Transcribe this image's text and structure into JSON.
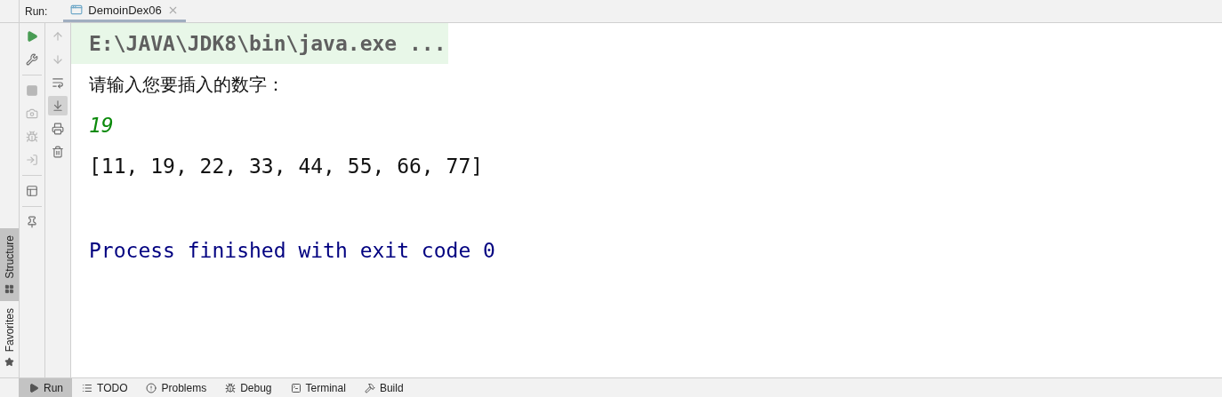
{
  "run_label": "Run:",
  "run_tab": {
    "label": "DemoinDex06",
    "selected": true
  },
  "side_tabs": [
    {
      "label": "Structure",
      "kind": "structure",
      "selected": true
    },
    {
      "label": "Favorites",
      "kind": "favorites",
      "selected": false
    }
  ],
  "tools_primary": [
    {
      "kind": "run",
      "disabled": false
    },
    {
      "kind": "wrench",
      "disabled": false
    },
    {
      "kind": "sep"
    },
    {
      "kind": "stop",
      "disabled": true
    },
    {
      "kind": "camera",
      "disabled": true
    },
    {
      "kind": "bug",
      "disabled": true
    },
    {
      "kind": "login",
      "disabled": true
    },
    {
      "kind": "sep"
    },
    {
      "kind": "layout",
      "disabled": false
    },
    {
      "kind": "sep"
    },
    {
      "kind": "pin",
      "disabled": false
    }
  ],
  "tools_secondary": [
    {
      "kind": "up",
      "disabled": true,
      "selected": false
    },
    {
      "kind": "down",
      "disabled": true,
      "selected": false
    },
    {
      "kind": "wrap",
      "disabled": false,
      "selected": false
    },
    {
      "kind": "scroll",
      "disabled": false,
      "selected": true
    },
    {
      "kind": "print",
      "disabled": false,
      "selected": false
    },
    {
      "kind": "trash",
      "disabled": false,
      "selected": false
    }
  ],
  "console": [
    {
      "kind": "command",
      "text": "E:\\JAVA\\JDK8\\bin\\java.exe ..."
    },
    {
      "kind": "prompt",
      "text": "请输入您要插入的数字："
    },
    {
      "kind": "input",
      "text": "19"
    },
    {
      "kind": "output",
      "text": "[11, 19, 22, 33, 44, 55, 66, 77]"
    },
    {
      "kind": "system",
      "text": "Process finished with exit code 0"
    }
  ],
  "bottom_tabs": [
    {
      "label": "Run",
      "kind": "run",
      "selected": true
    },
    {
      "label": "TODO",
      "kind": "todo",
      "selected": false
    },
    {
      "label": "Problems",
      "kind": "problems",
      "selected": false
    },
    {
      "label": "Debug",
      "kind": "debug",
      "selected": false
    },
    {
      "label": "Terminal",
      "kind": "terminal",
      "selected": false
    },
    {
      "label": "Build",
      "kind": "build",
      "selected": false
    }
  ]
}
